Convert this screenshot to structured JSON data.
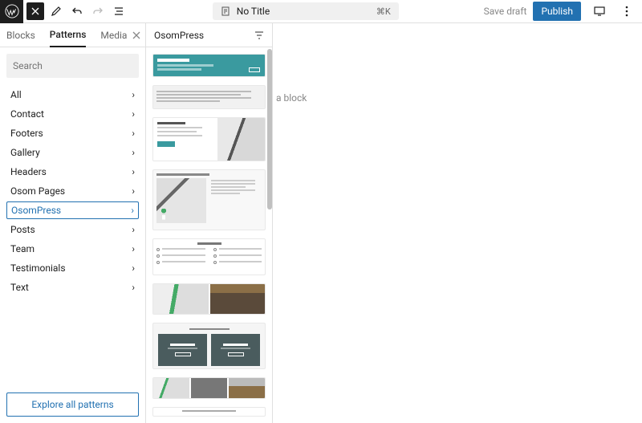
{
  "topbar": {
    "title": "No Title",
    "kbd": "⌘K",
    "save_draft": "Save draft",
    "publish": "Publish"
  },
  "tabs": {
    "blocks": "Blocks",
    "patterns": "Patterns",
    "media": "Media"
  },
  "search": {
    "placeholder": "Search"
  },
  "categories": [
    {
      "label": "All"
    },
    {
      "label": "Contact"
    },
    {
      "label": "Footers"
    },
    {
      "label": "Gallery"
    },
    {
      "label": "Headers"
    },
    {
      "label": "Osom Pages"
    },
    {
      "label": "OsomPress"
    },
    {
      "label": "Posts"
    },
    {
      "label": "Team"
    },
    {
      "label": "Testimonials"
    },
    {
      "label": "Text"
    }
  ],
  "explore_label": "Explore all patterns",
  "pattern_panel_title": "OsomPress",
  "canvas_hint": "a block"
}
